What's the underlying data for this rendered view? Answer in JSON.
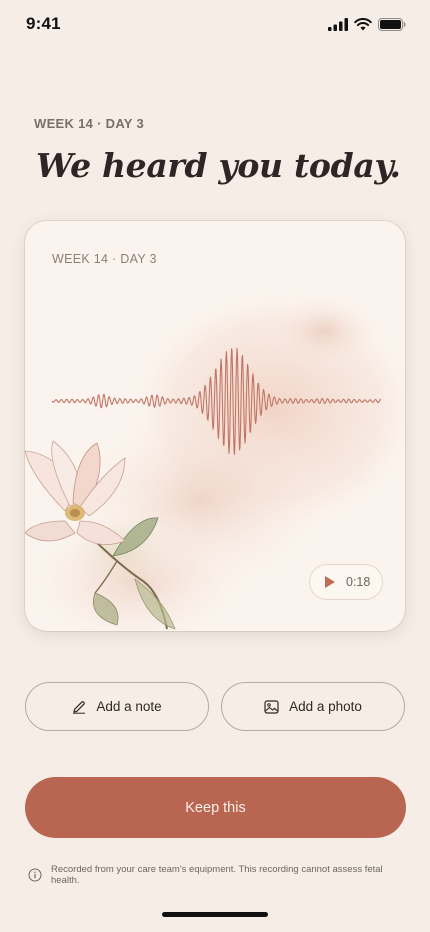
{
  "status_bar": {
    "time": "9:41"
  },
  "header": {
    "eyebrow": "WEEK 14 · DAY 3",
    "headline": "We heard you today."
  },
  "recording_card": {
    "label": "WEEK 14 · DAY 3",
    "duration": "0:18"
  },
  "actions": {
    "add_note": "Add a note",
    "add_photo": "Add a photo",
    "keep": "Keep this"
  },
  "disclaimer": "Recorded from your care team's equipment. This recording cannot assess fetal health.",
  "colors": {
    "background": "#f5ede6",
    "accent": "#b86651",
    "waveform": "#c07665"
  }
}
